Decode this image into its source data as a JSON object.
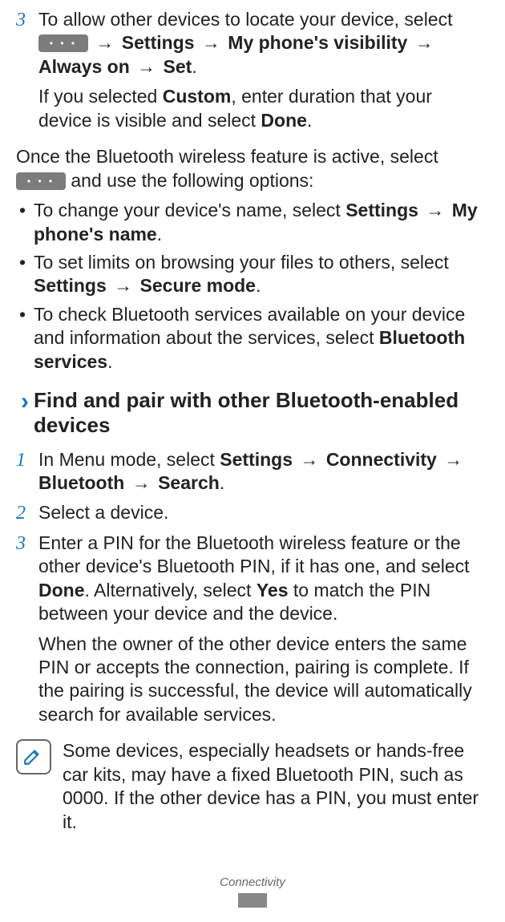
{
  "step3": {
    "num": "3",
    "t1": "To allow other devices to locate your device, select",
    "arrow": "→",
    "settings": "Settings",
    "visibility": "My phone's visibility",
    "always_on": "Always on",
    "set": "Set",
    "t2a": "If you selected",
    "custom": "Custom",
    "t2b": ", enter duration that your device is visible and select",
    "done": "Done"
  },
  "once": {
    "a": "Once the Bluetooth wireless feature is active, select",
    "b": "and use the following options:"
  },
  "bullets": {
    "b1a": "To change your device's name, select",
    "b1_settings": "Settings",
    "arrow": "→",
    "b1_mypname": "My phone's name",
    "b2a": "To set limits on browsing your files to others, select",
    "b2_settings": "Settings",
    "b2_secure": "Secure mode",
    "b3a": "To check Bluetooth services available on your device and information about the services, select",
    "b3_btsvc": "Bluetooth services"
  },
  "section": {
    "title": "Find and pair with other Bluetooth-enabled devices"
  },
  "find_steps": {
    "s1": {
      "num": "1",
      "a": "In Menu mode, select",
      "settings": "Settings",
      "arrow": "→",
      "connectivity": "Connectivity",
      "bluetooth": "Bluetooth",
      "search": "Search"
    },
    "s2": {
      "num": "2",
      "a": "Select a device."
    },
    "s3": {
      "num": "3",
      "a": "Enter a PIN for the Bluetooth wireless feature or the other device's Bluetooth PIN, if it has one, and select",
      "done": "Done",
      "alt_a": ". Alternatively, select",
      "yes": "Yes",
      "alt_b": "to match the PIN between your device and the device.",
      "p2": "When the owner of the other device enters the same PIN or accepts the connection, pairing is complete. If the pairing is successful, the device will automatically search for available services."
    }
  },
  "note": "Some devices, especially headsets or hands-free car kits, may have a fixed Bluetooth PIN, such as 0000. If the other device has a PIN, you must enter it.",
  "footer": "Connectivity"
}
